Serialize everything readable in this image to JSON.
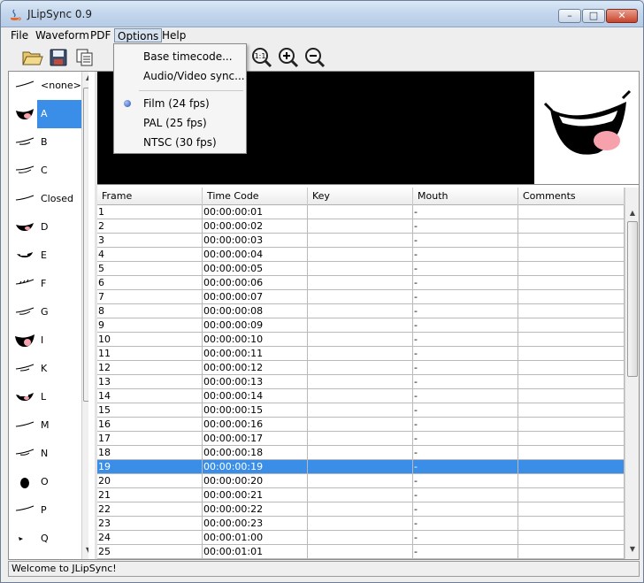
{
  "window": {
    "title": "JLipSync 0.9",
    "min_label": "–",
    "max_label": "□",
    "close_label": "✕"
  },
  "menubar": {
    "items": [
      "File",
      "Waveform",
      "PDF",
      "Options",
      "Help"
    ]
  },
  "options_menu": {
    "items": [
      "Base timecode...",
      "Audio/Video sync..."
    ],
    "frame_rates": [
      "Film (24 fps)",
      "PAL (25 fps)",
      "NTSC (30 fps)"
    ],
    "selected_frame_rate": "Film (24 fps)"
  },
  "toolbar": {
    "buttons": [
      "folder-open-icon",
      "save-icon",
      "copy-icon",
      "zoom-reset-icon",
      "zoom-in-icon",
      "zoom-out-icon"
    ],
    "zoom_reset_label": "1:1"
  },
  "mouth_list": {
    "items": [
      "<none>",
      "A",
      "B",
      "C",
      "Closed",
      "D",
      "E",
      "F",
      "G",
      "I",
      "K",
      "L",
      "M",
      "N",
      "O",
      "P",
      "Q"
    ],
    "selected": "A"
  },
  "grid": {
    "columns": [
      "Frame",
      "Time Code",
      "Key",
      "Mouth",
      "Comments"
    ],
    "rows": [
      [
        "1",
        "00:00:00:01",
        "",
        "-",
        ""
      ],
      [
        "2",
        "00:00:00:02",
        "",
        "-",
        ""
      ],
      [
        "3",
        "00:00:00:03",
        "",
        "-",
        ""
      ],
      [
        "4",
        "00:00:00:04",
        "",
        "-",
        ""
      ],
      [
        "5",
        "00:00:00:05",
        "",
        "-",
        ""
      ],
      [
        "6",
        "00:00:00:06",
        "",
        "-",
        ""
      ],
      [
        "7",
        "00:00:00:07",
        "",
        "-",
        ""
      ],
      [
        "8",
        "00:00:00:08",
        "",
        "-",
        ""
      ],
      [
        "9",
        "00:00:00:09",
        "",
        "-",
        ""
      ],
      [
        "10",
        "00:00:00:10",
        "",
        "-",
        ""
      ],
      [
        "11",
        "00:00:00:11",
        "",
        "-",
        ""
      ],
      [
        "12",
        "00:00:00:12",
        "",
        "-",
        ""
      ],
      [
        "13",
        "00:00:00:13",
        "",
        "-",
        ""
      ],
      [
        "14",
        "00:00:00:14",
        "",
        "-",
        ""
      ],
      [
        "15",
        "00:00:00:15",
        "",
        "-",
        ""
      ],
      [
        "16",
        "00:00:00:16",
        "",
        "-",
        ""
      ],
      [
        "17",
        "00:00:00:17",
        "",
        "-",
        ""
      ],
      [
        "18",
        "00:00:00:18",
        "",
        "-",
        ""
      ],
      [
        "19",
        "00:00:00:19",
        "",
        "-",
        ""
      ],
      [
        "20",
        "00:00:00:20",
        "",
        "-",
        ""
      ],
      [
        "21",
        "00:00:00:21",
        "",
        "-",
        ""
      ],
      [
        "22",
        "00:00:00:22",
        "",
        "-",
        ""
      ],
      [
        "23",
        "00:00:00:23",
        "",
        "-",
        ""
      ],
      [
        "24",
        "00:00:01:00",
        "",
        "-",
        ""
      ],
      [
        "25",
        "00:00:01:01",
        "",
        "-",
        ""
      ]
    ],
    "selected_frame": "19"
  },
  "status": {
    "text": "Welcome to JLipSync!"
  },
  "colors": {
    "selection": "#3b8ee8",
    "preview_bg": "#000000",
    "mouth_pink": "#f7a1ad"
  }
}
